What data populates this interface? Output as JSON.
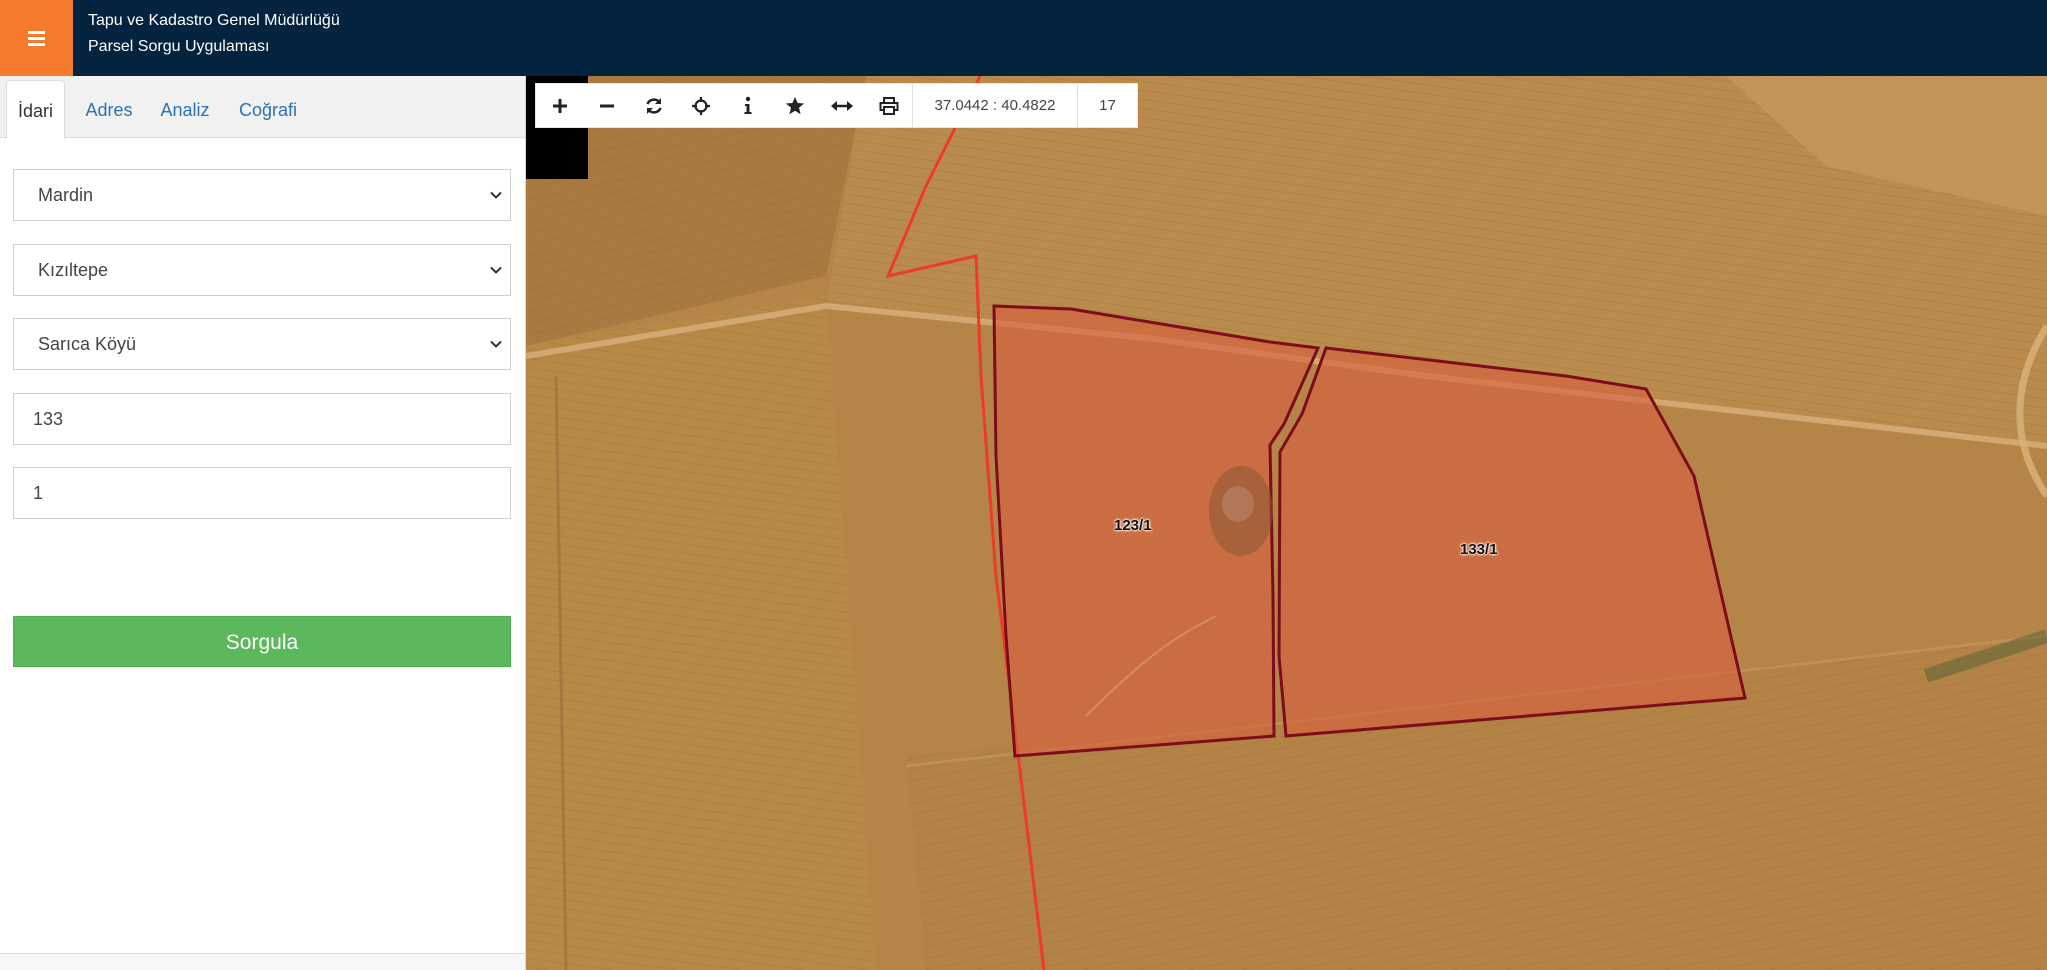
{
  "header": {
    "line1": "Tapu ve Kadastro Genel Müdürlüğü",
    "line2": "Parsel Sorgu Uygulaması",
    "menu_icon": "hamburger-icon",
    "background": "#03233f",
    "menu_color": "#f47b2d"
  },
  "tabs": [
    {
      "label": "İdari",
      "active": true
    },
    {
      "label": "Adres",
      "active": false
    },
    {
      "label": "Analiz",
      "active": false
    },
    {
      "label": "Coğrafi",
      "active": false
    }
  ],
  "form": {
    "il": "Mardin",
    "ilce": "Kızıltepe",
    "mahalle": "Sarıca Köyü",
    "ada": "133",
    "parsel": "1",
    "submit_label": "Sorgula",
    "submit_color": "#5cb85c"
  },
  "toolbar": {
    "icons": [
      "zoom-in-icon",
      "zoom-out-icon",
      "refresh-icon",
      "locate-icon",
      "info-icon",
      "star-icon",
      "measure-icon",
      "print-icon"
    ],
    "coordinates": "37.0442 : 40.4822",
    "zoom_level": "17"
  },
  "map": {
    "parcels": [
      {
        "label": "123/1",
        "color": "#d8603f"
      },
      {
        "label": "133/1",
        "color": "#d8603f"
      }
    ],
    "boundary_color": "#7d0d1c",
    "district_line_color": "#ee3a2a"
  }
}
